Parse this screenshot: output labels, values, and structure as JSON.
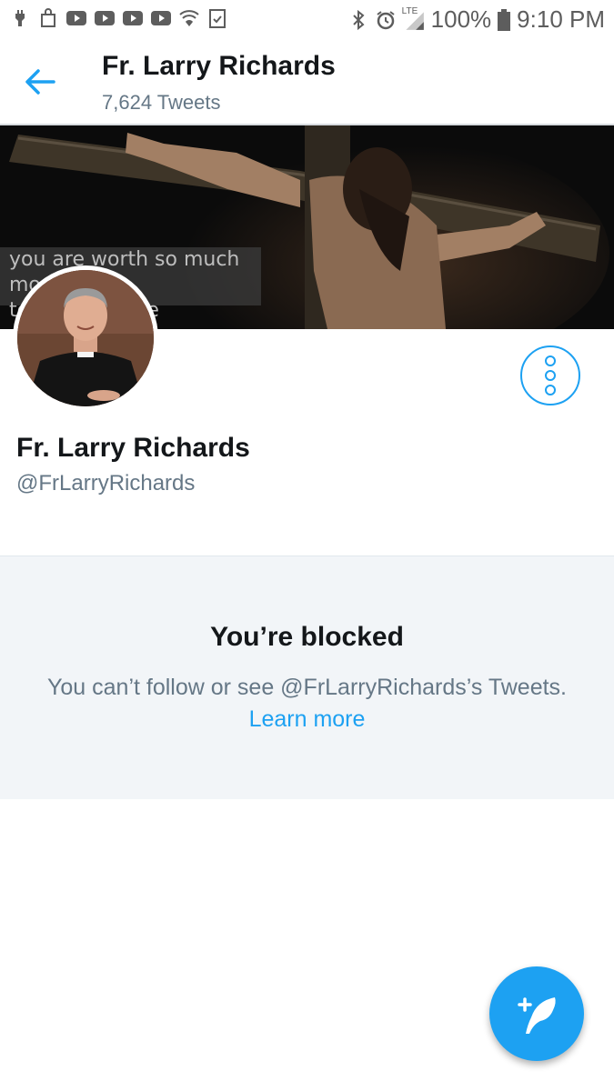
{
  "status_bar": {
    "battery": "100%",
    "time": "9:10 PM",
    "network_label": "LTE",
    "icons_left": [
      "usb-icon",
      "shopping-bag-icon",
      "youtube-icon",
      "youtube-icon",
      "youtube-icon",
      "youtube-icon",
      "wifi-shield-icon",
      "checklist-icon"
    ],
    "icons_right": [
      "bluetooth-icon",
      "alarm-icon",
      "signal-icon",
      "battery-icon"
    ]
  },
  "header": {
    "title": "Fr. Larry Richards",
    "tweet_count": "7,624 Tweets"
  },
  "banner": {
    "line1": "you are worth so much more",
    "line2": "to          realize"
  },
  "profile": {
    "name": "Fr. Larry Richards",
    "handle": "@FrLarryRichards"
  },
  "blocked": {
    "title": "You’re blocked",
    "message": "You can’t follow or see @FrLarryRichards’s Tweets.",
    "link": "Learn more"
  },
  "colors": {
    "accent": "#1da1f2",
    "text_primary": "#14171a",
    "text_secondary": "#657786",
    "panel_bg": "#f2f5f8"
  }
}
